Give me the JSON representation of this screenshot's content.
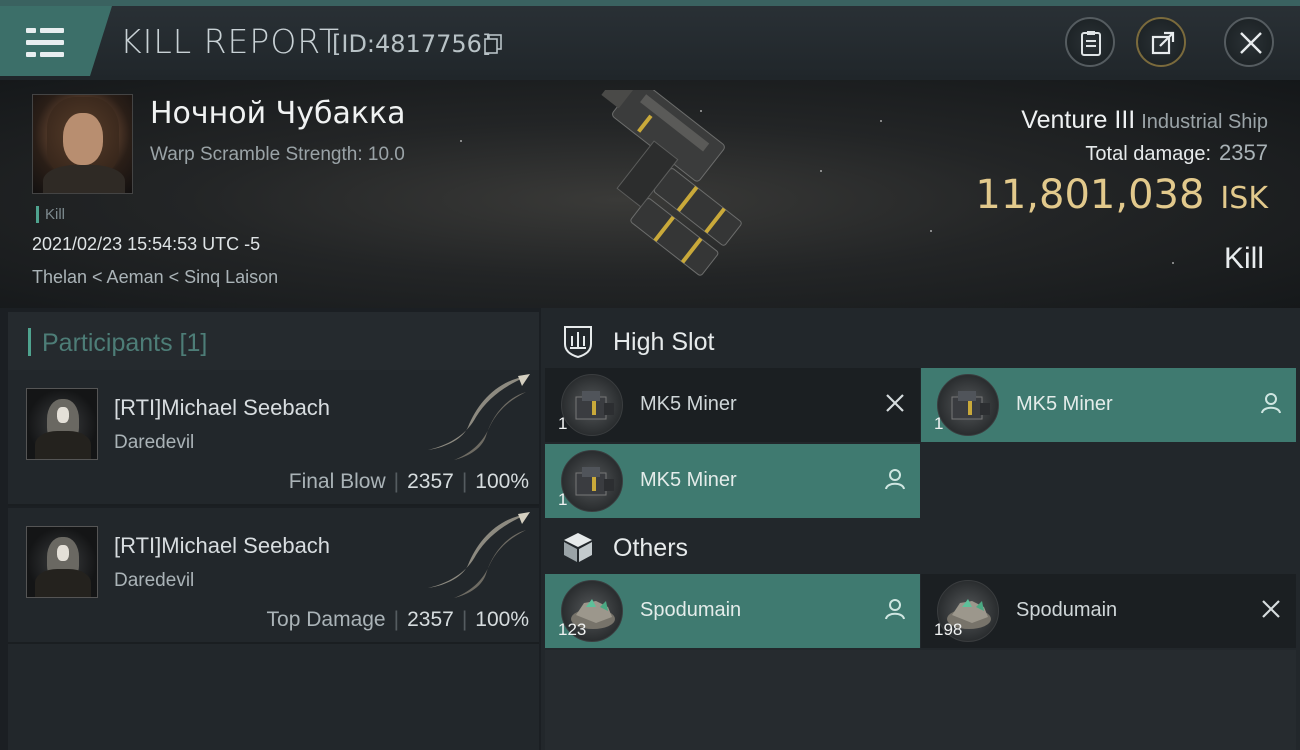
{
  "header": {
    "title": "KILL REPORT",
    "report_id": "[ID:4817756]"
  },
  "victim": {
    "name": "Ночной Чубакка",
    "warp_scramble": "Warp Scramble Strength: 10.0",
    "kill_tag": "Kill",
    "datetime": "2021/02/23 15:54:53 UTC -5",
    "location": "Thelan < Aeman < Sinq Laison",
    "ship_name": "Venture III",
    "ship_class": "Industrial Ship",
    "total_damage_label": "Total damage:",
    "total_damage": "2357",
    "isk_value": "11,801,038",
    "isk_unit": "ISK",
    "result": "Kill"
  },
  "participants": {
    "title": "Participants [1]",
    "rows": [
      {
        "pilot": "[RTI]Michael Seebach",
        "ship": "Daredevil",
        "role": "Final Blow",
        "damage": "2357",
        "percent": "100%"
      },
      {
        "pilot": "[RTI]Michael Seebach",
        "ship": "Daredevil",
        "role": "Top Damage",
        "damage": "2357",
        "percent": "100%"
      }
    ]
  },
  "fitting": {
    "high_slot_label": "High Slot",
    "others_label": "Others",
    "high_slot": [
      {
        "name": "MK5 Miner",
        "qty": "1",
        "status": "destroyed"
      },
      {
        "name": "MK5 Miner",
        "qty": "1",
        "status": "dropped"
      },
      {
        "name": "MK5 Miner",
        "qty": "1",
        "status": "dropped"
      }
    ],
    "others": [
      {
        "name": "Spodumain",
        "qty": "123",
        "status": "dropped"
      },
      {
        "name": "Spodumain",
        "qty": "198",
        "status": "destroyed"
      }
    ]
  },
  "icons": {
    "menu": "hamburger-menu-icon",
    "copy": "copy-icon",
    "report": "clipboard-icon",
    "share": "share-icon",
    "close": "close-icon",
    "high_slot": "high-slot-icon",
    "others": "cube-icon",
    "dropped": "person-icon",
    "destroyed": "x-icon"
  },
  "colors": {
    "accent": "#4fa38f",
    "dropped_bg": "#3f7a70",
    "isk": "#e2c98c"
  }
}
